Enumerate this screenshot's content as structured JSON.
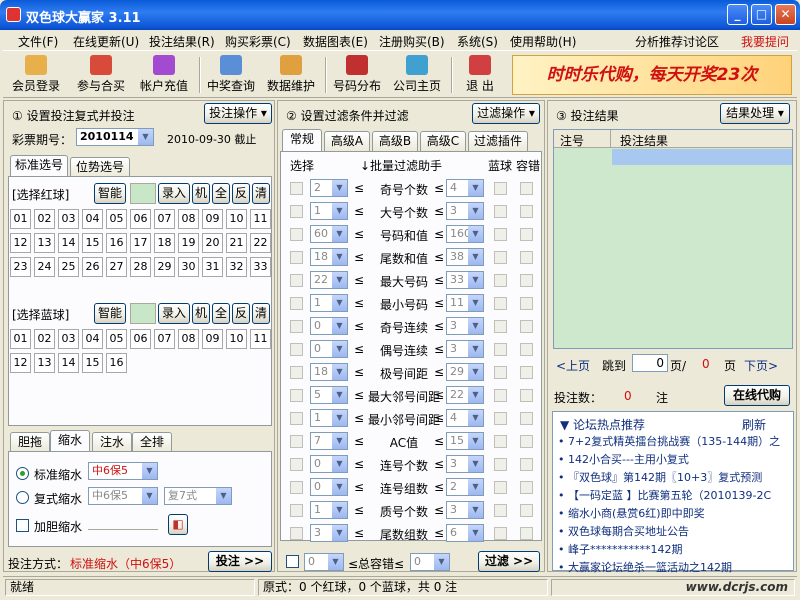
{
  "window": {
    "title": "双色球大赢家 3.11",
    "min": "_",
    "max": "□",
    "close": "✕"
  },
  "menu": [
    "文件(F)",
    "在线更新(U)",
    "投注结果(R)",
    "购买彩票(C)",
    "数据图表(E)",
    "注册购买(B)",
    "系统(S)",
    "使用帮助(H)"
  ],
  "menu_right": {
    "forum": "分析推荐讨论区",
    "help": "我要提问"
  },
  "toolbar": [
    "会员登录",
    "参与合买",
    "帐户充值",
    "中奖查询",
    "数据维护",
    "号码分布",
    "公司主页",
    "退 出"
  ],
  "banner": "时时乐代购，每天开奖23次",
  "p1": {
    "title": "① 设置投注复式并投注",
    "op_btn": "投注操作",
    "period_label": "彩票期号：",
    "period": "2010114",
    "date": "2010-09-30 截止",
    "tabs": [
      "标准选号",
      "位势选号"
    ],
    "red_label": "[选择红球]",
    "blue_label": "[选择蓝球]",
    "tools": [
      "智能",
      "录入",
      "机",
      "全",
      "反",
      "清"
    ],
    "reds": [
      "01",
      "02",
      "03",
      "04",
      "05",
      "06",
      "07",
      "08",
      "09",
      "10",
      "11",
      "12",
      "13",
      "14",
      "15",
      "16",
      "17",
      "18",
      "19",
      "20",
      "21",
      "22",
      "23",
      "24",
      "25",
      "26",
      "27",
      "28",
      "29",
      "30",
      "31",
      "32",
      "33"
    ],
    "blues": [
      "01",
      "02",
      "03",
      "04",
      "05",
      "06",
      "07",
      "08",
      "09",
      "10",
      "11",
      "12",
      "13",
      "14",
      "15",
      "16"
    ],
    "tabs2": [
      "胆拖",
      "缩水",
      "注水",
      "全排"
    ],
    "std_label": "标准缩水",
    "std_val": "中6保5",
    "cmp_label": "复式缩水",
    "cmp_val1": "中6保5",
    "cmp_val2": "复7式",
    "dan_label": "加胆缩水",
    "mode_label": "投注方式：",
    "mode_val": "标准缩水（中6保5）",
    "bet_btn": "投注 >>"
  },
  "p2": {
    "title": "② 设置过滤条件并过滤",
    "op_btn": "过滤操作",
    "tabs": [
      "常规",
      "高级A",
      "高级B",
      "高级C",
      "过滤插件"
    ],
    "col_sel": "选择",
    "col_helper": "↓批量过滤助手",
    "col_blue": "蓝球",
    "col_tol": "容错",
    "rows": [
      {
        "lo": "2",
        "name": "奇号个数",
        "hi": "4"
      },
      {
        "lo": "1",
        "name": "大号个数",
        "hi": "3"
      },
      {
        "lo": "60",
        "name": "号码和值",
        "hi": "160"
      },
      {
        "lo": "18",
        "name": "尾数和值",
        "hi": "38"
      },
      {
        "lo": "22",
        "name": "最大号码",
        "hi": "33"
      },
      {
        "lo": "1",
        "name": "最小号码",
        "hi": "11"
      },
      {
        "lo": "0",
        "name": "奇号连续",
        "hi": "3"
      },
      {
        "lo": "0",
        "name": "偶号连续",
        "hi": "3"
      },
      {
        "lo": "18",
        "name": "极号间距",
        "hi": "29"
      },
      {
        "lo": "5",
        "name": "最大邻号间距",
        "hi": "22"
      },
      {
        "lo": "1",
        "name": "最小邻号间距",
        "hi": "4"
      },
      {
        "lo": "7",
        "name": "AC值",
        "hi": "15"
      },
      {
        "lo": "0",
        "name": "连号个数",
        "hi": "3"
      },
      {
        "lo": "0",
        "name": "连号组数",
        "hi": "2"
      },
      {
        "lo": "1",
        "name": "质号个数",
        "hi": "3"
      },
      {
        "lo": "3",
        "name": "尾数组数",
        "hi": "6"
      }
    ],
    "le": "≤",
    "total_lo": "0",
    "total_label": "≤总容错≤",
    "total_hi": "0",
    "filter_btn": "过滤 >>"
  },
  "p3": {
    "title": "③ 投注结果",
    "op_btn": "结果处理",
    "col_no": "注号",
    "col_res": "投注结果",
    "prev": "<上页",
    "jump": "跳到",
    "page": "0",
    "page_sep": "页/",
    "pages": "0",
    "page_unit": "页",
    "next": "下页>",
    "count_label": "投注数：",
    "count": "0",
    "count_unit": "注",
    "buy_btn": "在线代购",
    "news_title": "▼ 论坛热点推荐",
    "refresh": "刷新",
    "news": [
      "7+2复式精英擂台挑战赛（135-144期）之",
      "142小合买---主用小复式",
      "『双色球』第142期〖10+3〗复式预测",
      "【一码定蓝 】比赛第五轮（2010139-2C",
      "缩水小商(悬赏6红)即中即奖",
      "双色球每期合买地址公告",
      "峰子***********142期",
      "大赢家论坛绝杀一篮活动之142期"
    ]
  },
  "status": {
    "ready": "就绪",
    "info": "原式：0 个红球，0 个蓝球，共 0 注",
    "watermark": "www.dcrjs.com"
  }
}
